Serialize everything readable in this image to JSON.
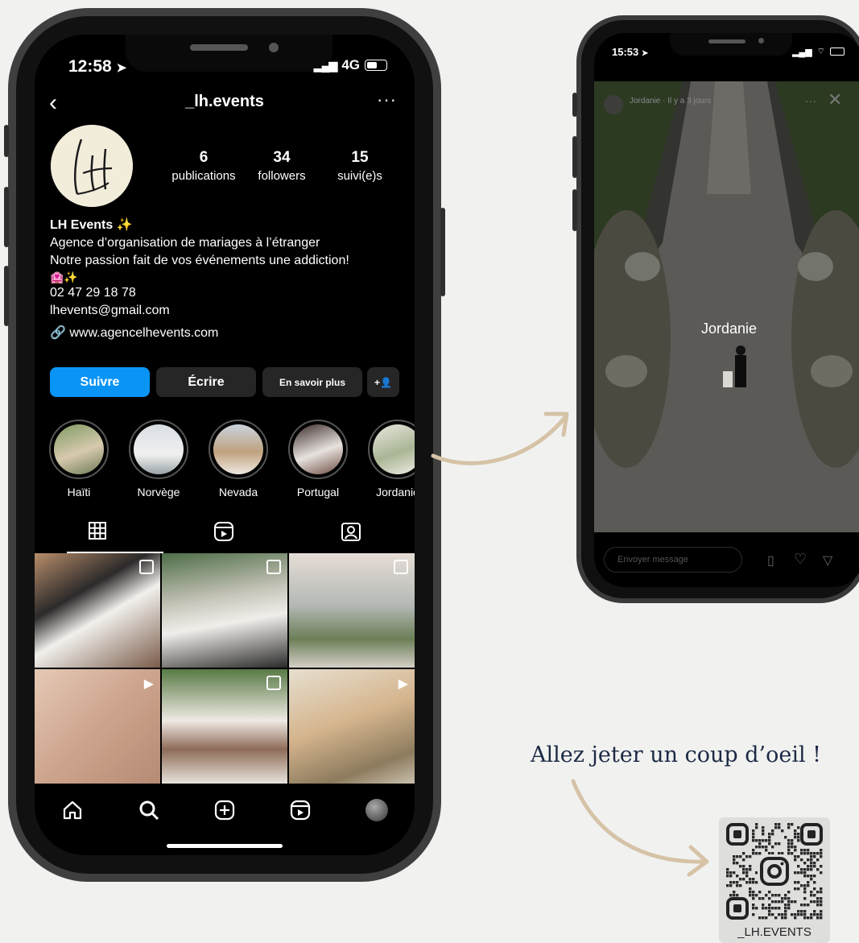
{
  "main_phone": {
    "status": {
      "time": "12:58",
      "network": "4G"
    },
    "header": {
      "username": "_lh.events"
    },
    "stats": [
      {
        "value": "6",
        "label": "publications"
      },
      {
        "value": "34",
        "label": "followers"
      },
      {
        "value": "15",
        "label": "suivi(e)s"
      }
    ],
    "bio": {
      "name": "LH Events",
      "name_emoji": "✨",
      "line1": "Agence d’organisation de mariages à l’étranger",
      "line2": "Notre passion fait de vos événements une addiction!",
      "emoji_line": "🏩✨",
      "phone": "02 47 29 18 78",
      "email": "lhevents@gmail.com",
      "website": "www.agencelhevents.com"
    },
    "actions": {
      "follow": "Suivre",
      "message": "Écrire",
      "more_info": "En savoir plus",
      "add_user_glyph": "+👤"
    },
    "highlights": [
      {
        "label": "Haïti"
      },
      {
        "label": "Norvège"
      },
      {
        "label": "Nevada"
      },
      {
        "label": "Portugal"
      },
      {
        "label": "Jordanie"
      }
    ]
  },
  "story_phone": {
    "status": {
      "time": "15:53"
    },
    "story_user": "Jordanie · Il y a 3 jours",
    "story_title": "Jordanie",
    "message_placeholder": "Envoyer message"
  },
  "cta": {
    "text": "Allez jeter un coup d’oeil !"
  },
  "qr": {
    "label": "_LH.EVENTS"
  },
  "colors": {
    "follow_blue": "#0a95f6",
    "arrow": "#d6c3a7",
    "cta_text": "#1d2a45"
  }
}
